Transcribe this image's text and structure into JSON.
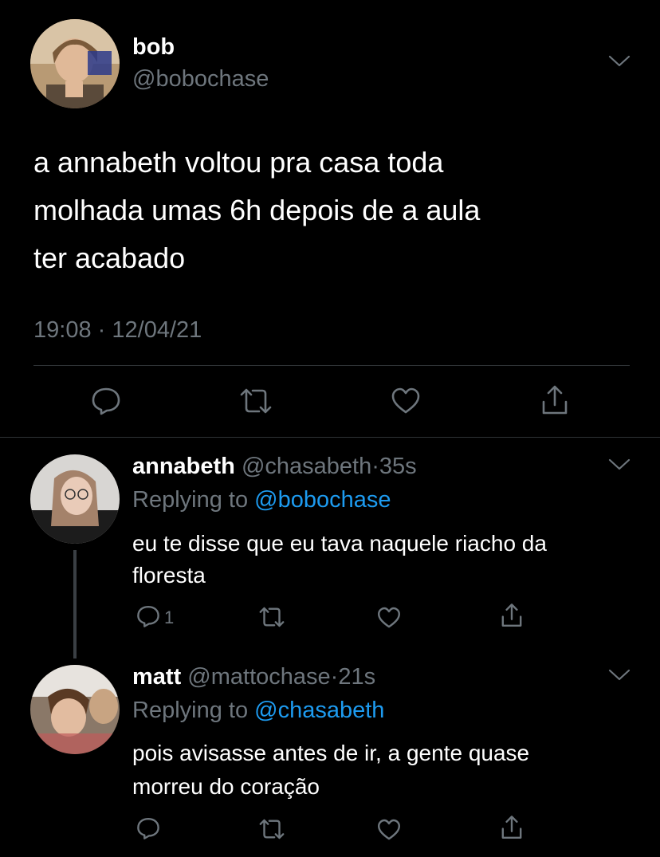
{
  "main_tweet": {
    "display_name": "bob",
    "handle": "@bobochase",
    "text_lines": [
      "a annabeth voltou pra casa toda",
      "molhada umas 6h depois de a aula",
      "ter acabado"
    ],
    "time": "19:08",
    "separator": "·",
    "date": "12/04/21"
  },
  "replies": [
    {
      "display_name": "annabeth",
      "handle": "@chasabeth",
      "dot": "·",
      "age": "35s",
      "replying_prefix": "Replying to",
      "replying_to": "@bobochase",
      "text_lines": [
        "eu te disse que eu tava naquele riacho da",
        "floresta"
      ],
      "reply_count": "1"
    },
    {
      "display_name": "matt",
      "handle": "@mattochase",
      "dot": "·",
      "age": "21s",
      "replying_prefix": "Replying to",
      "replying_to": "@chasabeth",
      "text_lines": [
        "pois avisasse antes de ir, a gente quase",
        "morreu do coração"
      ],
      "reply_count": ""
    }
  ],
  "icons": {
    "reply": "reply-icon",
    "retweet": "retweet-icon",
    "like": "like-icon",
    "share": "share-icon",
    "more": "chevron-down-icon"
  },
  "colors": {
    "background": "#000000",
    "text": "#ffffff",
    "secondary": "#6e767d",
    "link": "#1d9bf0",
    "divider": "#2f3336"
  }
}
